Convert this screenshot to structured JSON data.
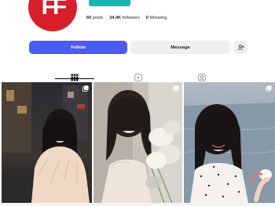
{
  "profile": {
    "avatar_text": "FF",
    "stats": {
      "posts_count": "60",
      "posts_label": "posts",
      "followers_count": "34.4K",
      "followers_label": "followers",
      "following_count": "0",
      "following_label": "following"
    }
  },
  "actions": {
    "follow_label": "Follow",
    "message_label": "Message"
  },
  "tabs": [
    {
      "icon": "grid-icon"
    },
    {
      "icon": "reels-icon"
    },
    {
      "icon": "tagged-icon"
    }
  ],
  "colors": {
    "brand_red": "#d71f2b",
    "follow_blue": "#4b5cf0",
    "teal": "#19b3b0"
  }
}
